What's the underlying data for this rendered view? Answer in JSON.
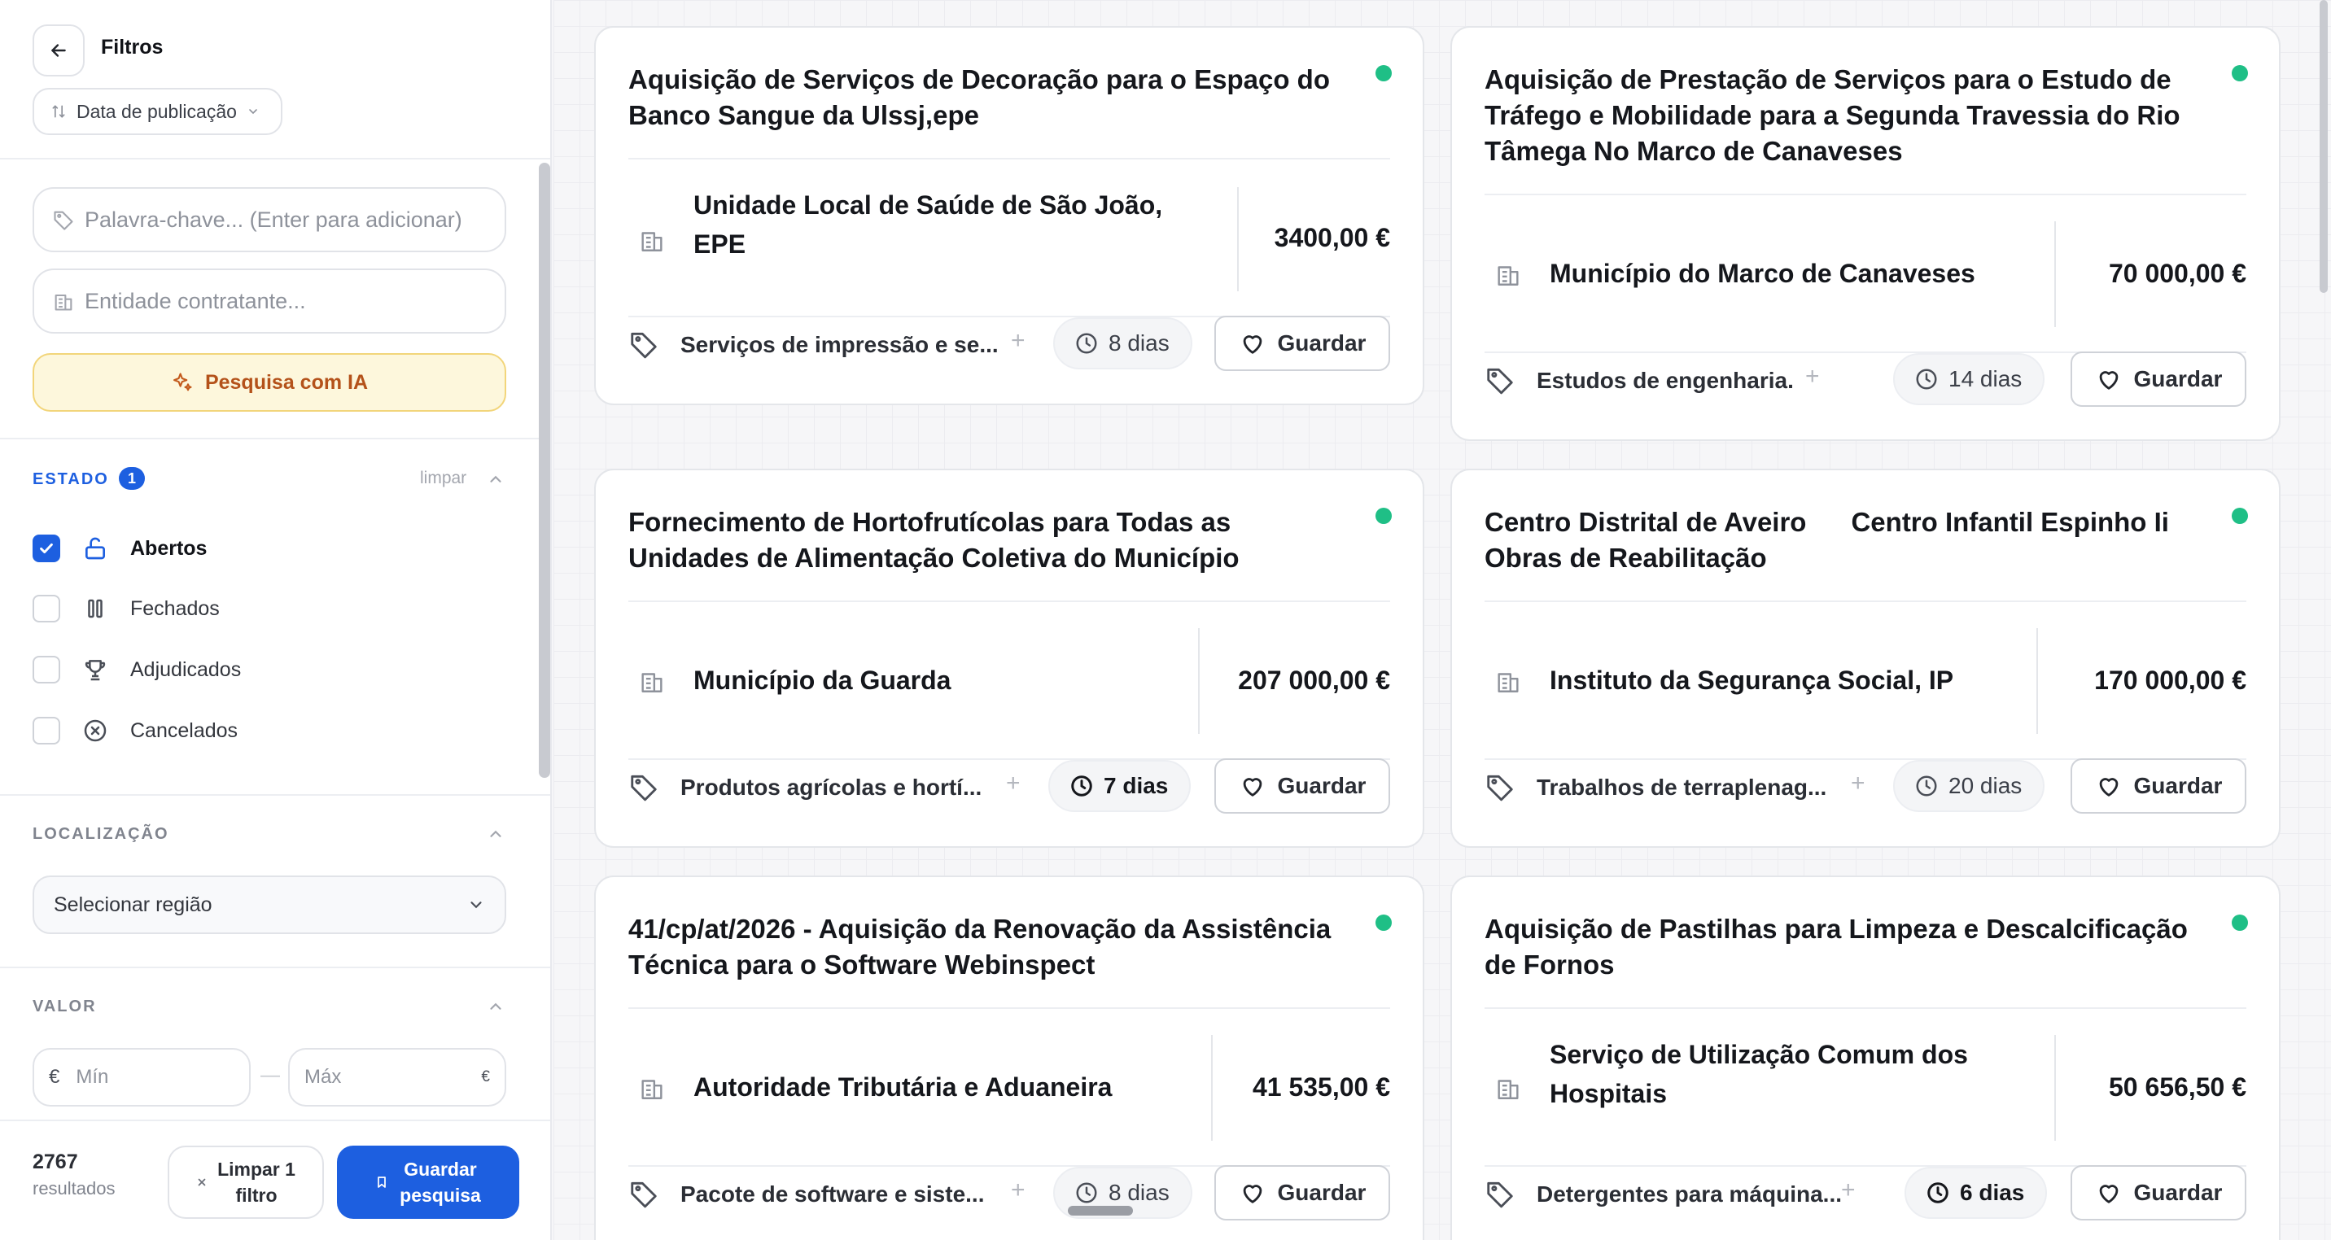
{
  "sidebar": {
    "title": "Filtros",
    "sort_label": "Data de publicação",
    "keyword_placeholder": "Palavra-chave... (Enter para adicionar)",
    "entity_placeholder": "Entidade contratante...",
    "ai_button": "Pesquisa com IA",
    "estado": {
      "label": "ESTADO",
      "badge": "1",
      "clear": "limpar",
      "items": [
        {
          "label": "Abertos",
          "checked": true,
          "icon": "lock-open-icon"
        },
        {
          "label": "Fechados",
          "checked": false,
          "icon": "pause-icon"
        },
        {
          "label": "Adjudicados",
          "checked": false,
          "icon": "trophy-icon"
        },
        {
          "label": "Cancelados",
          "checked": false,
          "icon": "x-circle-icon"
        }
      ]
    },
    "localizacao": {
      "label": "LOCALIZAÇÃO",
      "select_value": "Selecionar região"
    },
    "valor": {
      "label": "VALOR",
      "min_prefix": "€",
      "min_placeholder": "Mín",
      "dash": "—",
      "max_placeholder": "Máx",
      "max_suffix": "€"
    },
    "footer": {
      "count": "2767",
      "count_label": "resultados",
      "clear_line1": "Limpar 1",
      "clear_line2": "filtro",
      "save_line1": "Guardar",
      "save_line2": "pesquisa"
    }
  },
  "cards": [
    {
      "title": "Aquisição de Serviços de Decoração para o Espaço do Banco Sangue da Ulssj,epe",
      "entity": "Unidade Local de Saúde de São João, EPE",
      "price": "3400,00 €",
      "tag": "Serviços de impressão e se...",
      "days": "8 dias",
      "days_bold": false,
      "save": "Guardar",
      "status_color": "#1fbf86"
    },
    {
      "title": "Aquisição de Prestação de Serviços para o Estudo de Tráfego e Mobilidade para a Segunda Travessia do Rio Tâmega No Marco de Canaveses",
      "entity": "Município do Marco de Canaveses",
      "price": "70 000,00 €",
      "tag": "Estudos de engenharia.",
      "days": "14 dias",
      "days_bold": false,
      "save": "Guardar",
      "status_color": "#1fbf86"
    },
    {
      "title": "Fornecimento de Hortofrutícolas para Todas as Unidades de Alimentação Coletiva do Município",
      "entity": "Município da Guarda",
      "price": "207 000,00 €",
      "tag": "Produtos agrícolas e hortí...",
      "days": "7 dias",
      "days_bold": true,
      "save": "Guardar",
      "status_color": "#1fbf86"
    },
    {
      "title": "Centro Distrital de Aveiro      Centro Infantil Espinho Ii Obras de Reabilitação",
      "entity": "Instituto da Segurança Social, IP",
      "price": "170 000,00 €",
      "tag": "Trabalhos de terraplenag...",
      "days": "20 dias",
      "days_bold": false,
      "save": "Guardar",
      "status_color": "#1fbf86"
    },
    {
      "title": "41/cp/at/2026 - Aquisição da Renovação da Assistência Técnica para o Software Webinspect",
      "entity": "Autoridade Tributária e Aduaneira",
      "price": "41 535,00 €",
      "tag": "Pacote de software e siste...",
      "days": "8 dias",
      "days_bold": false,
      "save": "Guardar",
      "status_color": "#1fbf86"
    },
    {
      "title": "Aquisição de Pastilhas para Limpeza e Descalcificação de Fornos",
      "entity": "Serviço de Utilização Comum dos Hospitais",
      "price": "50 656,50 €",
      "tag": "Detergentes para máquina...",
      "days": "6 dias",
      "days_bold": true,
      "save": "Guardar",
      "status_color": "#1fbf86"
    }
  ],
  "colors": {
    "accent": "#1d5fe0",
    "status_open": "#1fbf86",
    "ai_text": "#b4521a",
    "ai_bg": "#fdf7dc"
  }
}
